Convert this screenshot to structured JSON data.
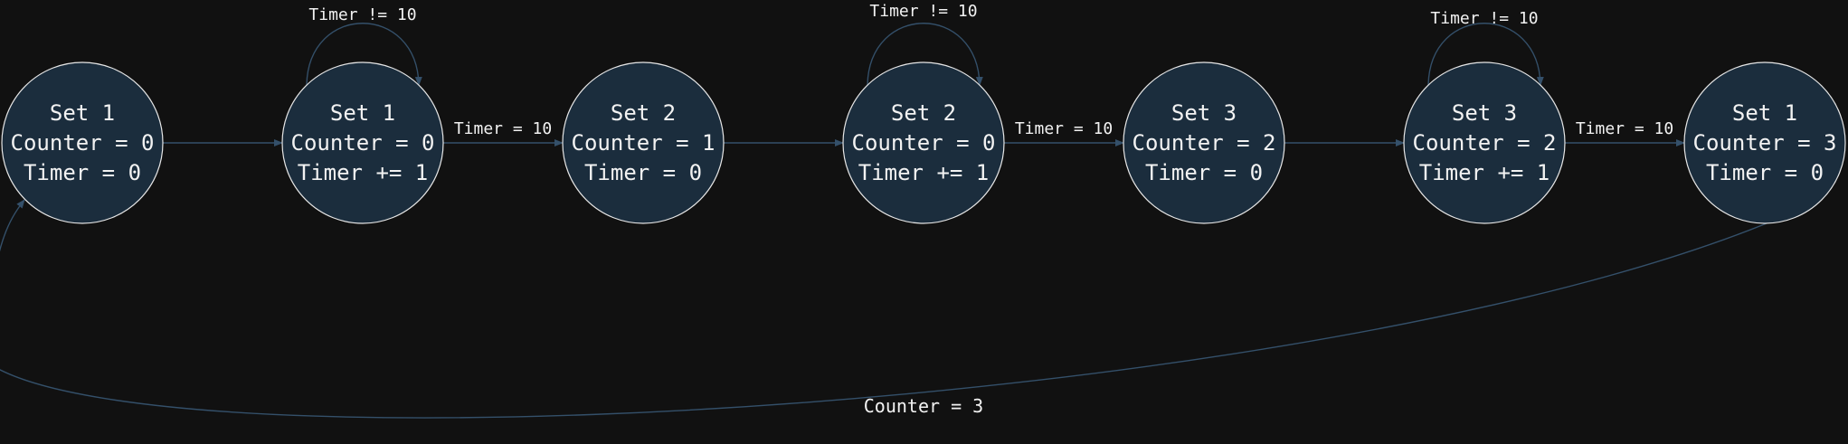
{
  "diagram": {
    "nodes": [
      {
        "id": "n1",
        "lines": [
          "Set 1",
          "Counter = 0",
          "Timer = 0"
        ]
      },
      {
        "id": "n2",
        "lines": [
          "Set 1",
          "Counter = 0",
          "Timer += 1"
        ]
      },
      {
        "id": "n3",
        "lines": [
          "Set 2",
          "Counter = 1",
          "Timer = 0"
        ]
      },
      {
        "id": "n4",
        "lines": [
          "Set 2",
          "Counter = 0",
          "Timer += 1"
        ]
      },
      {
        "id": "n5",
        "lines": [
          "Set 3",
          "Counter = 2",
          "Timer = 0"
        ]
      },
      {
        "id": "n6",
        "lines": [
          "Set 3",
          "Counter = 2",
          "Timer += 1"
        ]
      },
      {
        "id": "n7",
        "lines": [
          "Set 1",
          "Counter = 3",
          "Timer = 0"
        ]
      }
    ],
    "edges": [
      {
        "from": "n1",
        "to": "n2",
        "label": ""
      },
      {
        "from": "n2",
        "to": "n3",
        "label": "Timer = 10"
      },
      {
        "from": "n3",
        "to": "n4",
        "label": ""
      },
      {
        "from": "n4",
        "to": "n5",
        "label": "Timer = 10"
      },
      {
        "from": "n5",
        "to": "n6",
        "label": ""
      },
      {
        "from": "n6",
        "to": "n7",
        "label": "Timer = 10"
      }
    ],
    "self_loops": [
      {
        "node": "n2",
        "label": "Timer != 10"
      },
      {
        "node": "n4",
        "label": "Timer != 10"
      },
      {
        "node": "n6",
        "label": "Timer != 10"
      }
    ],
    "return_edge": {
      "from": "n7",
      "to": "n1",
      "label": "Counter = 3"
    },
    "colors": {
      "background": "#111111",
      "node_fill": "#1b2d3d",
      "node_stroke": "#e6e6e6",
      "edge": "#34506a",
      "text": "#f2f2f2"
    }
  }
}
